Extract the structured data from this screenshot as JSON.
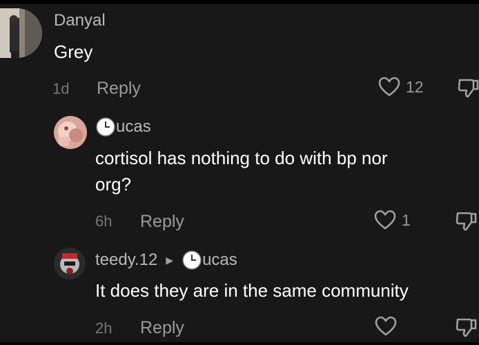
{
  "comments": [
    {
      "username": "Danyal",
      "text": "Grey",
      "time": "1d",
      "reply_label": "Reply",
      "likes": "12"
    },
    {
      "username": "ucas",
      "text_line1": "cortisol has nothing to do with bp nor",
      "text_line2": "org?",
      "time": "6h",
      "reply_label": "Reply",
      "likes": "1"
    },
    {
      "username": "teedy.12",
      "reply_to": "ucas",
      "text": "It does they are in the same community",
      "time": "2h",
      "reply_label": "Reply",
      "likes": ""
    }
  ],
  "colors": {
    "background": "#181818",
    "username": "#b9b9b9",
    "comment_text": "#ffffff",
    "meta": "#777777"
  },
  "icons": [
    "heart-icon",
    "dislike-icon",
    "clock-icon",
    "reply-arrow-icon"
  ]
}
